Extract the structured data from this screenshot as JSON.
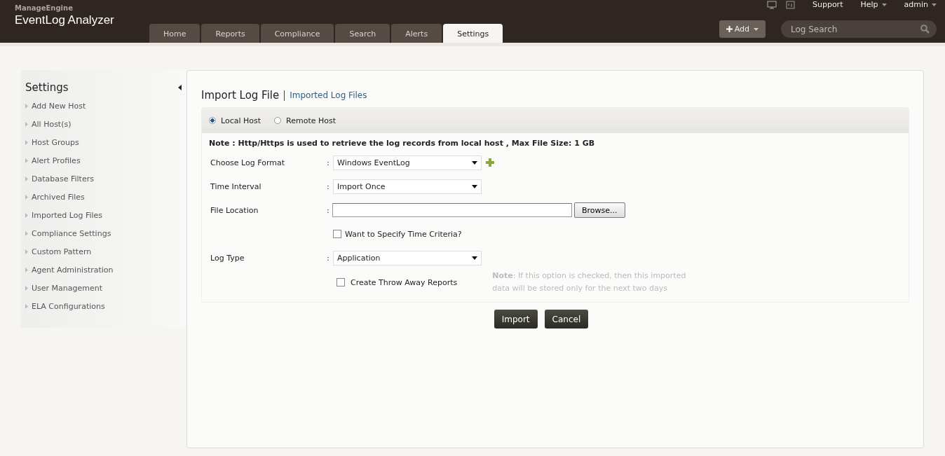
{
  "header": {
    "brand_small": "ManageEngine",
    "brand": "EventLog Analyzer",
    "top_links": [
      {
        "label": "Support",
        "dropdown": false
      },
      {
        "label": "Help",
        "dropdown": true
      },
      {
        "label": "admin",
        "dropdown": true
      }
    ],
    "tabs": [
      {
        "label": "Home",
        "selected": false
      },
      {
        "label": "Reports",
        "selected": false
      },
      {
        "label": "Compliance",
        "selected": false
      },
      {
        "label": "Search",
        "selected": false
      },
      {
        "label": "Alerts",
        "selected": false
      },
      {
        "label": "Settings",
        "selected": true
      }
    ],
    "add_button": "Add",
    "search": {
      "placeholder": "Log Search"
    }
  },
  "sidebar": {
    "title": "Settings",
    "items": [
      "Add New Host",
      "All Host(s)",
      "Host Groups",
      "Alert Profiles",
      "Database Filters",
      "Archived Files",
      "Imported Log Files",
      "Compliance Settings",
      "Custom Pattern",
      "Agent Administration",
      "User Management",
      "ELA Configurations"
    ]
  },
  "main": {
    "title": "Import Log File",
    "link": "Imported Log Files",
    "hosts": [
      {
        "label": "Local Host",
        "selected": true
      },
      {
        "label": "Remote Host",
        "selected": false
      }
    ],
    "note": "Note : Http/Https is used to retrieve the log records from local host , Max File Size: 1 GB",
    "rows": [
      {
        "kind": "select",
        "label": "Choose Log Format",
        "colon": ":",
        "value": "Windows EventLog",
        "add": true
      },
      {
        "kind": "select",
        "label": "Time Interval",
        "colon": ":",
        "value": "Import Once",
        "add": false
      },
      {
        "kind": "file",
        "label": "File Location",
        "colon": ":",
        "button": "Browse..."
      },
      {
        "kind": "check",
        "label": "Want to Specify Time Criteria?",
        "checked": false
      },
      {
        "kind": "select",
        "label": "Log Type",
        "colon": ":",
        "value": "Application",
        "add": false
      },
      {
        "kind": "check",
        "label": "Create Throw Away Reports",
        "checked": false,
        "hint": "**Note**: If this option is checked, then this imported data will be stored only for the next two days"
      }
    ],
    "buttons": [
      "Import",
      "Cancel"
    ]
  }
}
